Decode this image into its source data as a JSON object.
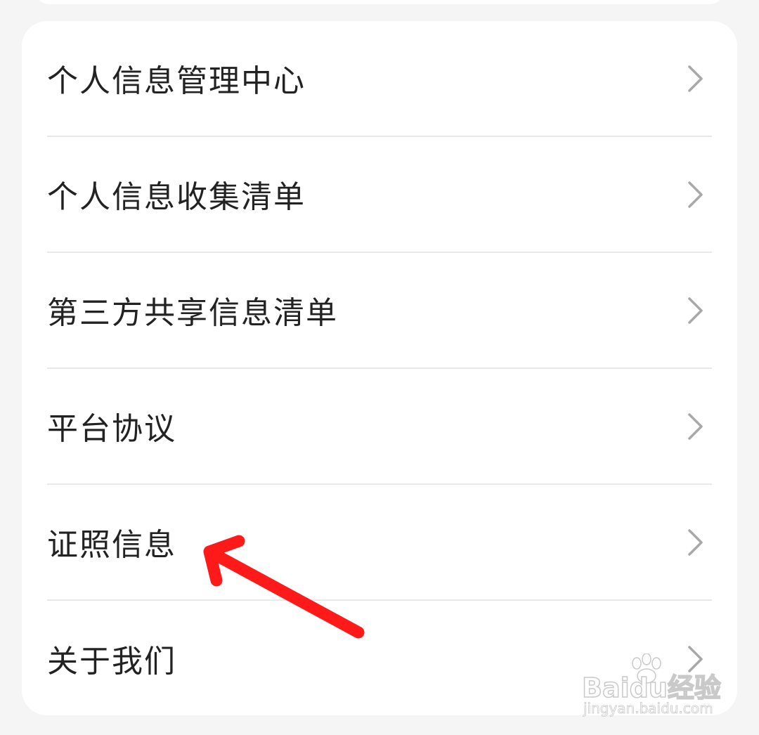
{
  "menu": {
    "items": [
      {
        "label": "个人信息管理中心",
        "icon": "chevron-right-icon"
      },
      {
        "label": "个人信息收集清单",
        "icon": "chevron-right-icon"
      },
      {
        "label": "第三方共享信息清单",
        "icon": "chevron-right-icon"
      },
      {
        "label": "平台协议",
        "icon": "chevron-right-icon"
      },
      {
        "label": "证照信息",
        "icon": "chevron-right-icon"
      },
      {
        "label": "关于我们",
        "icon": "chevron-right-icon"
      }
    ]
  },
  "annotation": {
    "type": "arrow",
    "color": "#ff1a1a",
    "points_to": "证照信息"
  },
  "watermark": {
    "brand": "Baidu经验",
    "domain": "jingyan.baidu.com"
  },
  "colors": {
    "background": "#f5f5f5",
    "card": "#ffffff",
    "text": "#222222",
    "divider": "#e9e9e9",
    "chevron": "#a8a8a8"
  }
}
